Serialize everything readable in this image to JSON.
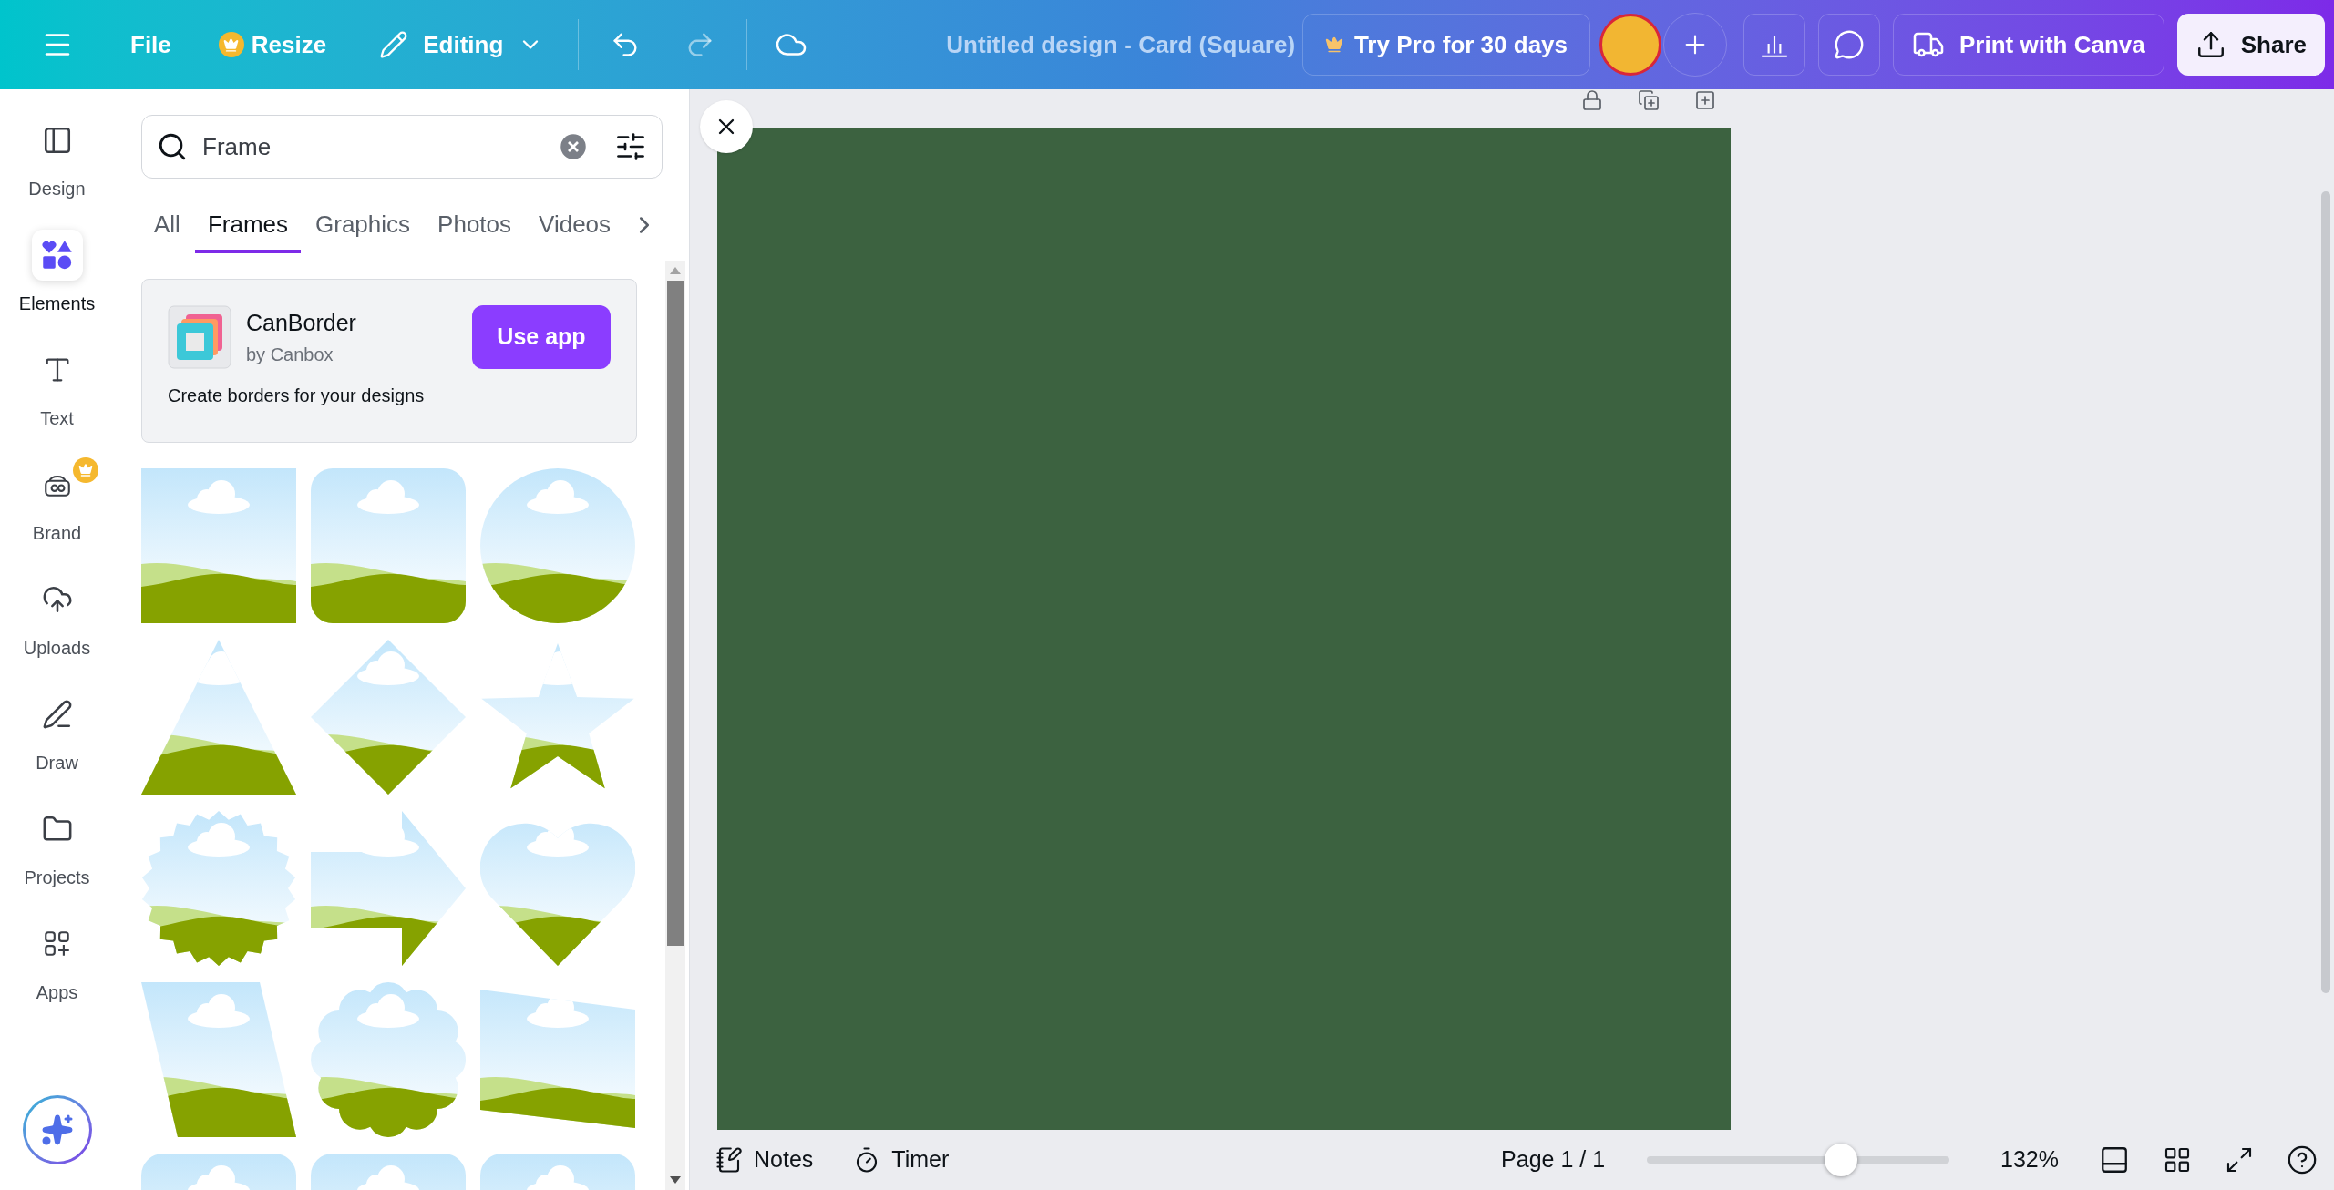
{
  "top_bar": {
    "file": "File",
    "resize": "Resize",
    "mode": "Editing",
    "title": "Untitled design - Card (Square)",
    "pro": "Try Pro for 30 days",
    "print": "Print with Canva",
    "share": "Share"
  },
  "sidebar": {
    "items": [
      {
        "kind": "design",
        "label": "Design",
        "selected": false,
        "pro_badge": false
      },
      {
        "kind": "elements",
        "label": "Elements",
        "selected": true,
        "pro_badge": false
      },
      {
        "kind": "text",
        "label": "Text",
        "selected": false,
        "pro_badge": false
      },
      {
        "kind": "brand",
        "label": "Brand",
        "selected": false,
        "pro_badge": true
      },
      {
        "kind": "uploads",
        "label": "Uploads",
        "selected": false,
        "pro_badge": false
      },
      {
        "kind": "draw",
        "label": "Draw",
        "selected": false,
        "pro_badge": false
      },
      {
        "kind": "projects",
        "label": "Projects",
        "selected": false,
        "pro_badge": false
      },
      {
        "kind": "apps",
        "label": "Apps",
        "selected": false,
        "pro_badge": false
      }
    ]
  },
  "search": {
    "value": "Frame"
  },
  "tabs": [
    {
      "label": "All",
      "selected": false
    },
    {
      "label": "Frames",
      "selected": true
    },
    {
      "label": "Graphics",
      "selected": false
    },
    {
      "label": "Photos",
      "selected": false
    },
    {
      "label": "Videos",
      "selected": false
    }
  ],
  "app_card": {
    "name": "CanBorder",
    "author": "by Canbox",
    "button": "Use app",
    "description": "Create borders for your designs"
  },
  "frames": [
    {
      "kind": "square"
    },
    {
      "kind": "rounded"
    },
    {
      "kind": "circle"
    },
    {
      "kind": "triangle"
    },
    {
      "kind": "diamond"
    },
    {
      "kind": "star"
    },
    {
      "kind": "burst"
    },
    {
      "kind": "arrow"
    },
    {
      "kind": "heart"
    },
    {
      "kind": "parallelogram"
    },
    {
      "kind": "scallop"
    },
    {
      "kind": "tilted"
    },
    {
      "kind": "rounded"
    },
    {
      "kind": "rounded"
    },
    {
      "kind": "rounded"
    }
  ],
  "bottom_bar": {
    "notes": "Notes",
    "timer": "Timer",
    "page": "Page 1 / 1",
    "zoom": {
      "level": 0.64,
      "reading": "132%"
    }
  }
}
